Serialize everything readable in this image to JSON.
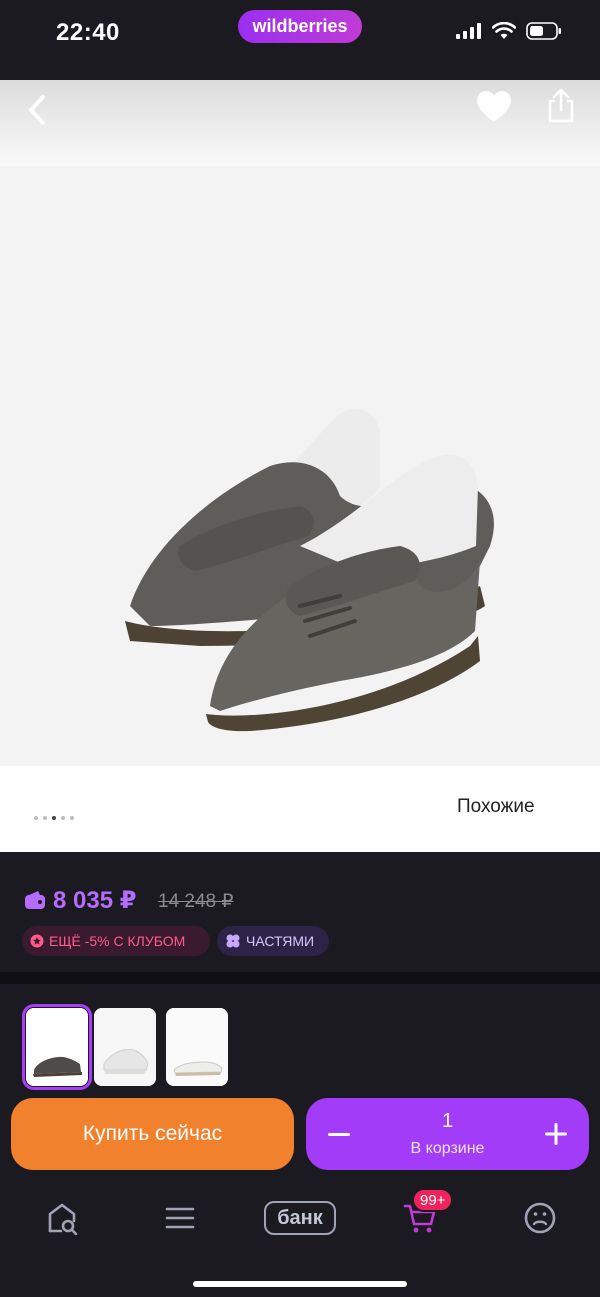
{
  "status_bar": {
    "time": "22:40",
    "brand": "wildberries",
    "icons": [
      "cellular-signal-icon",
      "wifi-icon",
      "battery-icon"
    ]
  },
  "header": {
    "back_icon": "chevron-left-icon",
    "favorite_icon": "heart-icon",
    "share_icon": "share-icon"
  },
  "gallery": {
    "image": "grey suede sneakers with gum soles",
    "dots_total": 5,
    "active_dot": 3,
    "similar_label": "Похожие"
  },
  "price": {
    "current": "8 035 ₽",
    "old": "14 248 ₽",
    "badges": [
      {
        "label": "ЕЩЁ -5% С КЛУБОМ",
        "icon": "club-star-icon",
        "color": "#ff5c8a"
      },
      {
        "label": "ЧАСТЯМИ",
        "icon": "installments-icon",
        "color": "#d8c6ff"
      }
    ]
  },
  "colors_variants": [
    {
      "name": "grey",
      "selected": true
    },
    {
      "name": "white",
      "selected": false
    },
    {
      "name": "white-beige",
      "selected": false
    }
  ],
  "actions": {
    "buy_now": "Купить сейчас",
    "quantity": "1",
    "in_cart_label": "В корзине"
  },
  "tab_bar": {
    "items": [
      "home-search-icon",
      "catalog-icon",
      "bank-icon",
      "cart-icon",
      "profile-icon"
    ],
    "bank_label": "банк",
    "cart_badge": "99+"
  },
  "theme": {
    "accent": "#a33cf8",
    "buy_now": "#f2812e",
    "price": "#b66bff",
    "background": "#1b1a21"
  }
}
